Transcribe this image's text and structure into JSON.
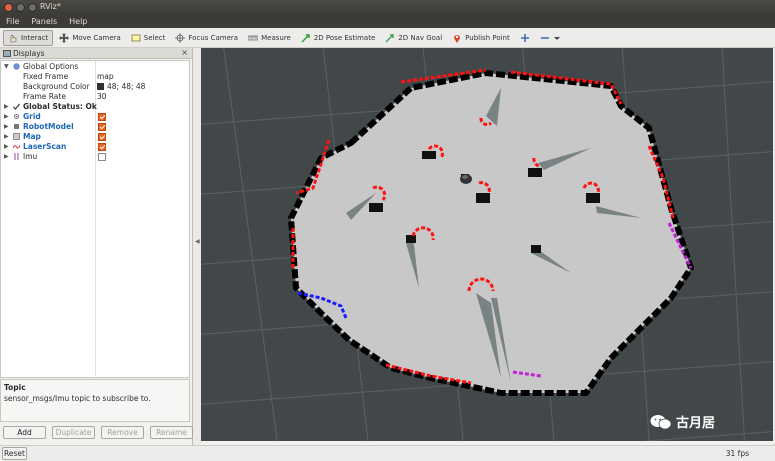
{
  "window": {
    "title": "RViz*"
  },
  "menu": [
    "File",
    "Panels",
    "Help"
  ],
  "toolbar": {
    "tools": [
      {
        "label": "Interact",
        "icon": "interact-icon",
        "active": true
      },
      {
        "label": "Move Camera",
        "icon": "move-camera-icon"
      },
      {
        "label": "Select",
        "icon": "select-icon"
      },
      {
        "label": "Focus Camera",
        "icon": "focus-camera-icon"
      },
      {
        "label": "Measure",
        "icon": "measure-icon"
      },
      {
        "label": "2D Pose Estimate",
        "icon": "pose-estimate-icon"
      },
      {
        "label": "2D Nav Goal",
        "icon": "nav-goal-icon"
      },
      {
        "label": "Publish Point",
        "icon": "publish-point-icon"
      }
    ]
  },
  "displays": {
    "title": "Displays",
    "rows": [
      {
        "label": "Global Options",
        "value": ""
      },
      {
        "label": "Fixed Frame",
        "value": "map"
      },
      {
        "label": "Background Color",
        "value": "48; 48; 48"
      },
      {
        "label": "Frame Rate",
        "value": "30"
      },
      {
        "label": "Global Status: Ok",
        "value": ""
      },
      {
        "label": "Grid",
        "checked": true
      },
      {
        "label": "RobotModel",
        "checked": true
      },
      {
        "label": "Map",
        "checked": true
      },
      {
        "label": "LaserScan",
        "checked": true
      },
      {
        "label": "Imu",
        "checked": false
      }
    ],
    "topic": {
      "title": "Topic",
      "description": "sensor_msgs/Imu topic to subscribe to."
    },
    "buttons": {
      "add": "Add",
      "duplicate": "Duplicate",
      "remove": "Remove",
      "rename": "Rename"
    }
  },
  "status": {
    "reset": "Reset",
    "fps": "31 fps"
  },
  "watermark": "古月居",
  "colors": {
    "background": "#303030",
    "map_free": "#c8c8c8",
    "laser": "#ff0000"
  }
}
